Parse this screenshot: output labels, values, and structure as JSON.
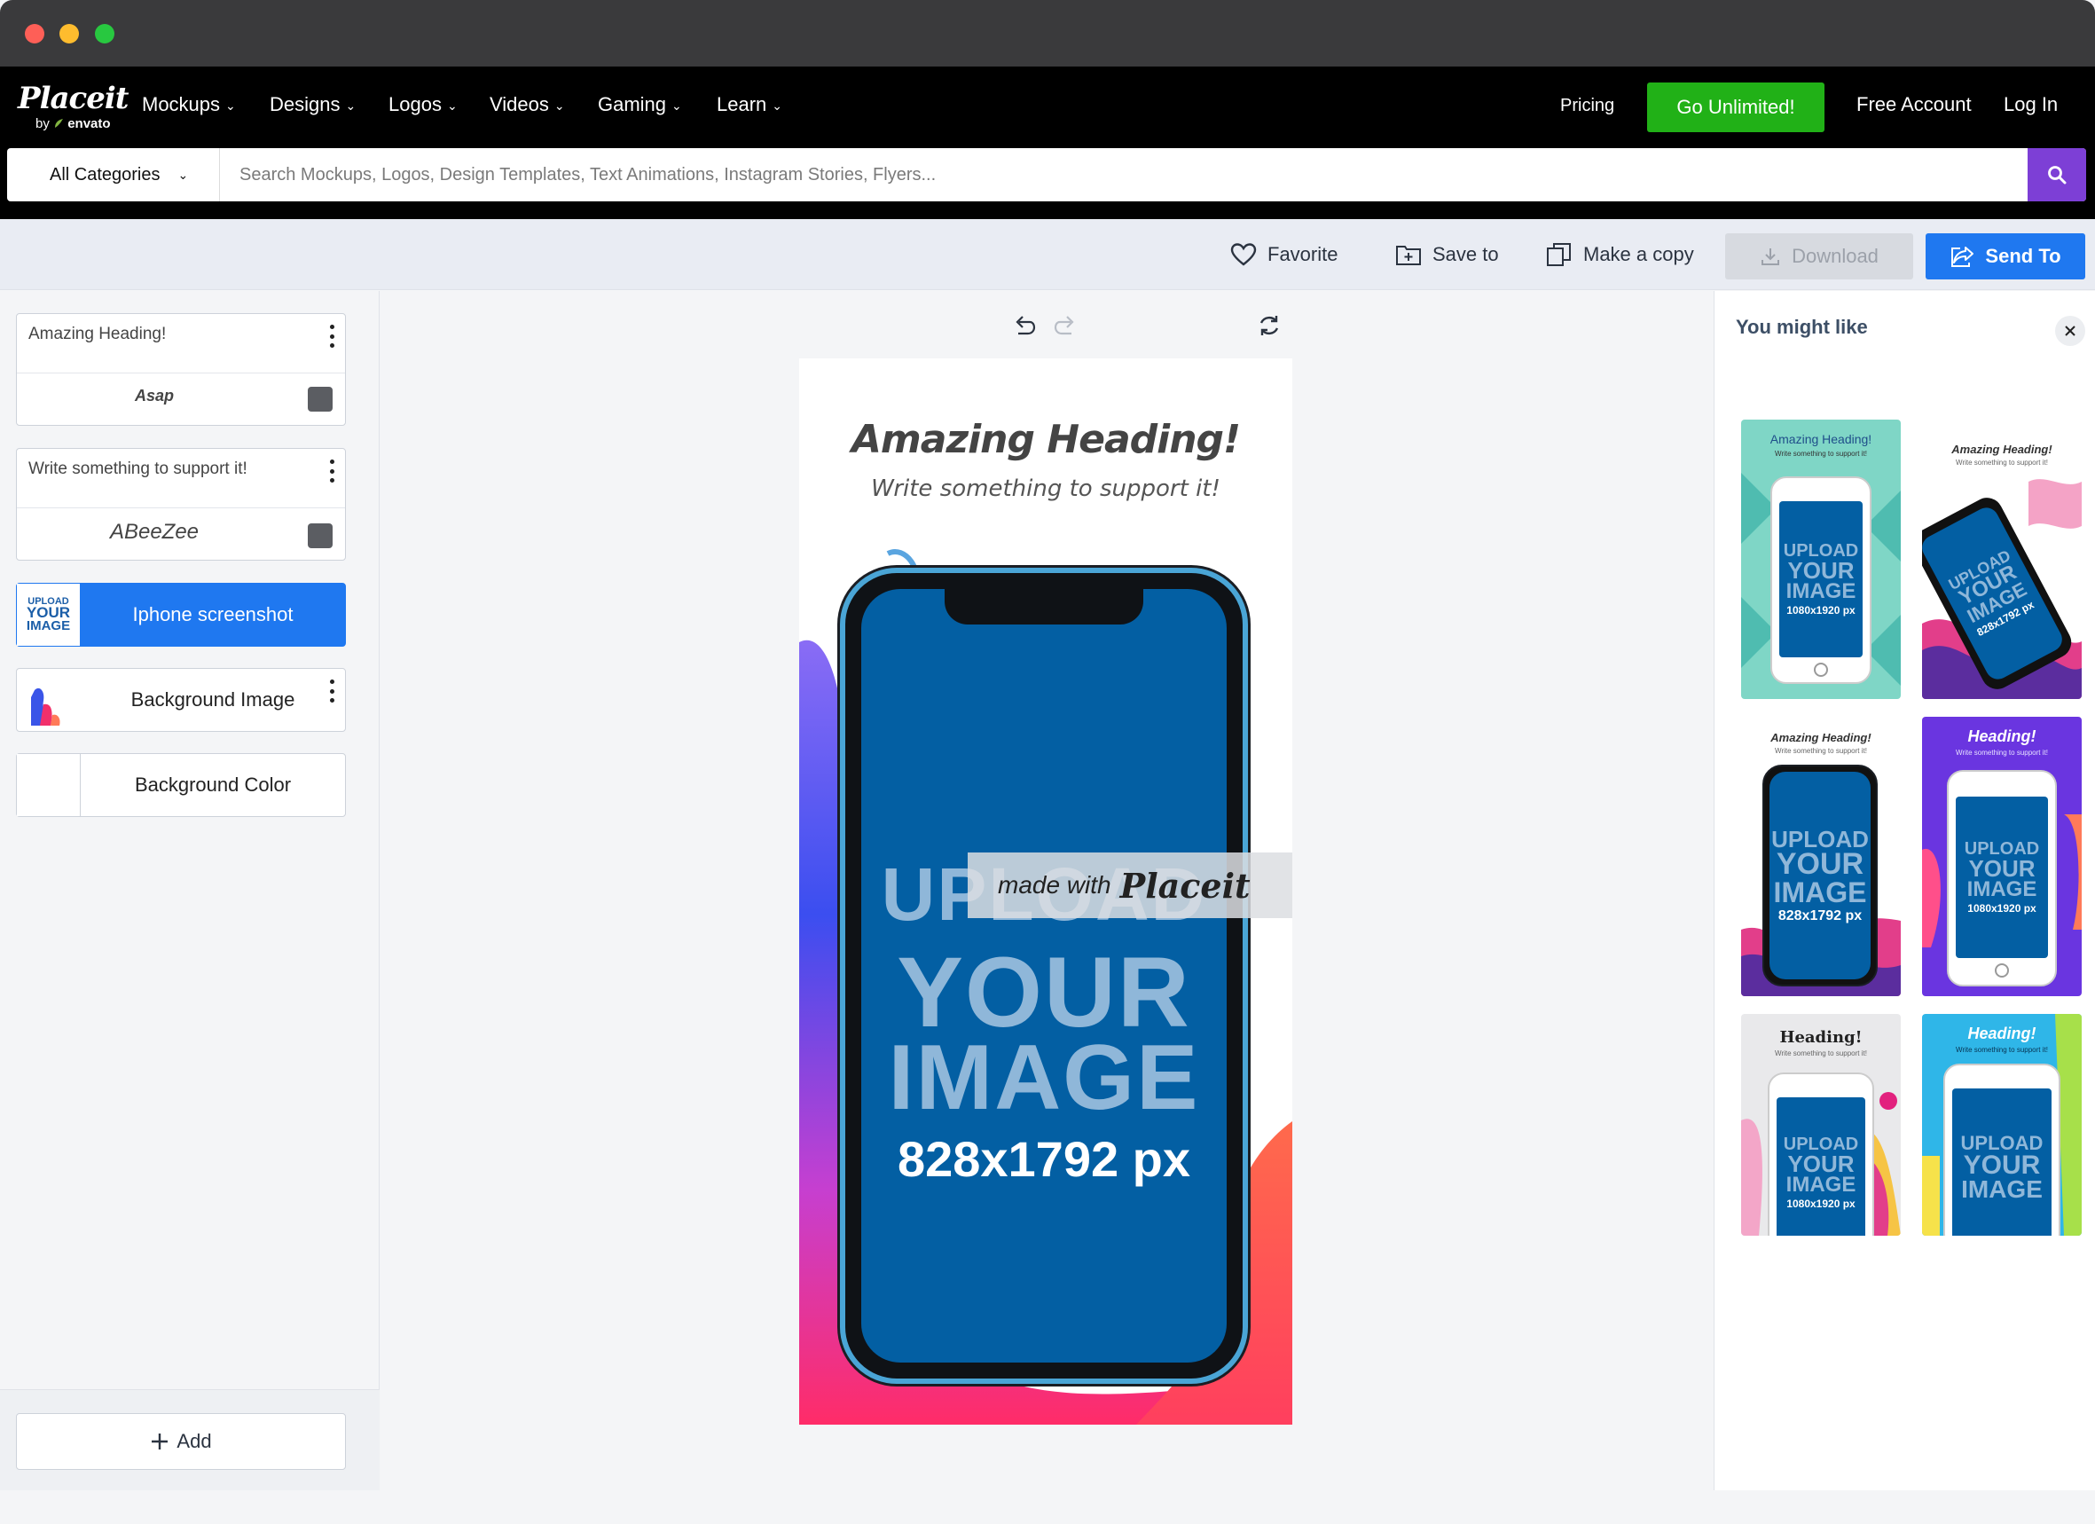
{
  "nav": {
    "logo_main": "Placeit",
    "logo_by": "by",
    "logo_envato": "envato",
    "items": [
      {
        "label": "Mockups"
      },
      {
        "label": "Designs"
      },
      {
        "label": "Logos"
      },
      {
        "label": "Videos"
      },
      {
        "label": "Gaming"
      },
      {
        "label": "Learn"
      }
    ],
    "pricing": "Pricing",
    "unlimited": "Go Unlimited!",
    "free_account": "Free Account",
    "login": "Log In",
    "colors": {
      "unlimited": "#21b117",
      "search_button": "#7d3fd6"
    }
  },
  "search": {
    "category": "All Categories",
    "placeholder": "Search Mockups, Logos, Design Templates, Text Animations, Instagram Stories, Flyers..."
  },
  "toolbar": {
    "favorite": "Favorite",
    "save_to": "Save to",
    "make_copy": "Make a copy",
    "download": "Download",
    "send_to": "Send To",
    "colors": {
      "send_to": "#1f78f0"
    }
  },
  "layers": [
    {
      "text": "Amazing Heading!",
      "font": "Asap"
    },
    {
      "text": "Write something to support it!",
      "font": "ABeeZee"
    },
    {
      "label": "Iphone screenshot",
      "thumb": [
        "UPLOAD",
        "YOUR",
        "IMAGE"
      ]
    },
    {
      "label": "Background Image"
    },
    {
      "label": "Background Color"
    }
  ],
  "add_button": "Add",
  "artboard": {
    "heading": "Amazing Heading!",
    "subheading": "Write something to support it!",
    "upload": [
      "UPLOAD",
      "YOUR",
      "IMAGE"
    ],
    "size": "828x1792 px",
    "watermark_small": "made with",
    "watermark_big": "Placeit"
  },
  "suggestions": {
    "title": "You might like",
    "items": [
      {
        "heading": "Amazing Heading!",
        "sub": "Write something to support it!",
        "upload": [
          "UPLOAD",
          "YOUR",
          "IMAGE"
        ],
        "size": "1080x1920 px"
      },
      {
        "heading": "Amazing Heading!",
        "sub": "Write something to support it!",
        "upload": [
          "UPLOAD",
          "YOUR",
          "IMAGE"
        ],
        "size": "828x1792 px"
      },
      {
        "heading": "Amazing Heading!",
        "sub": "Write something to support it!",
        "upload": [
          "UPLOAD",
          "YOUR",
          "IMAGE"
        ],
        "size": "828x1792 px"
      },
      {
        "heading": "Heading!",
        "sub": "Write something to support it!",
        "upload": [
          "UPLOAD",
          "YOUR",
          "IMAGE"
        ],
        "size": "1080x1920 px"
      },
      {
        "heading": "Heading!",
        "sub": "Write something to support it!",
        "upload": [
          "UPLOAD",
          "YOUR",
          "IMAGE"
        ],
        "size": "1080x1920 px"
      },
      {
        "heading": "Heading!",
        "sub": "Write something to support it!",
        "upload": [
          "UPLOAD",
          "YOUR",
          "IMAGE"
        ]
      }
    ]
  }
}
